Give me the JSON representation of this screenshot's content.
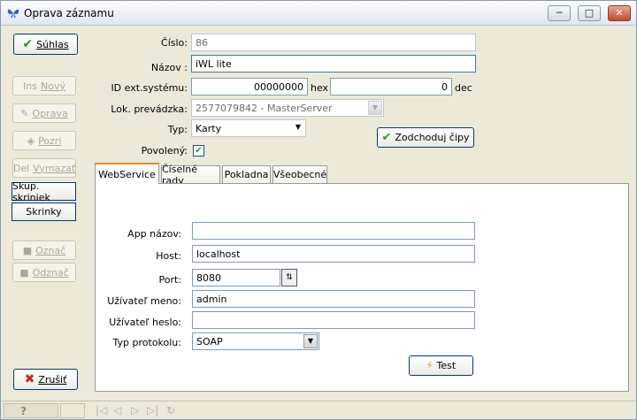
{
  "window": {
    "title": "Oprava záznamu",
    "icon": "butterfly-icon",
    "controls": {
      "minimize": "─",
      "maximize": "□",
      "close": "✕"
    }
  },
  "sidebar": {
    "confirm": {
      "icon": "check-icon",
      "label": "Súhlas"
    },
    "new": {
      "prefix": "Ins",
      "label": "Nový"
    },
    "edit": {
      "icon": "pencil-icon",
      "label": "Oprava"
    },
    "view": {
      "icon": "eye-icon",
      "label": "Pozri"
    },
    "delete": {
      "prefix": "Del",
      "label": "Vymazať"
    },
    "group_cabinets": "Skup. skriniek",
    "cabinets": "Skrinky",
    "mark": {
      "icon": "mark-icon",
      "label": "Označ"
    },
    "unmark": {
      "icon": "unmark-icon",
      "label": "Odznač"
    },
    "cancel": {
      "icon": "x-icon",
      "label": "Zrušiť"
    }
  },
  "form": {
    "number": {
      "label": "Číslo:",
      "value": "86"
    },
    "name": {
      "label": "Názov :",
      "value": "iWL lite"
    },
    "ext_id": {
      "label": "ID ext.systému:",
      "hex_value": "00000000",
      "hex_unit": "hex",
      "dec_value": "0",
      "dec_unit": "dec"
    },
    "location": {
      "label": "Lok. prevádzka:",
      "value": "2577079842 - MasterServer"
    },
    "type": {
      "label": "Typ:",
      "value": "Karty"
    },
    "enabled": {
      "label": "Povolený:",
      "checked": true
    },
    "sync_button": {
      "icon": "double-check-icon",
      "label": "Zodchoduj čipy"
    }
  },
  "tabs": [
    "WebService",
    "Číselné rady",
    "Pokladna",
    "Všeobecné"
  ],
  "webservice": {
    "app_name": {
      "label": "App názov:",
      "value": ""
    },
    "host": {
      "label": "Host:",
      "value": "localhost"
    },
    "port": {
      "label": "Port:",
      "value": "8080"
    },
    "user": {
      "label": "Užívateľ meno:",
      "value": "admin"
    },
    "password": {
      "label": "Užívateľ heslo:",
      "value": ""
    },
    "protocol": {
      "label": "Typ protokolu:",
      "value": "SOAP"
    },
    "test_button": {
      "icon": "lightning-icon",
      "label": "Test"
    }
  },
  "statusbar": {
    "help": "?",
    "nav": [
      "|◁",
      "◁",
      "▷",
      "▷|",
      "↻"
    ]
  }
}
